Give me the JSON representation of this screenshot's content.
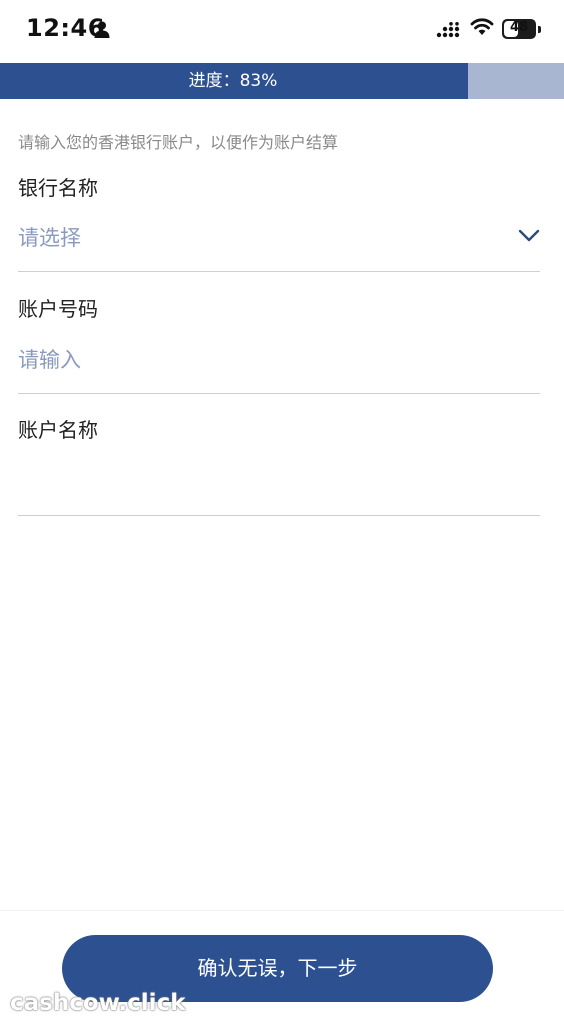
{
  "status_bar": {
    "time": "12:46",
    "battery": "48",
    "battery_level": 0.48
  },
  "progress": {
    "label": "进度：83%",
    "value": 0.83
  },
  "hint": "请输入您的香港银行账户，以便作为账户结算",
  "fields": [
    {
      "label": "银行名称",
      "value": "请选择"
    },
    {
      "label": "账户号码",
      "placeholder": "请输入"
    },
    {
      "label": "账户名称",
      "value": ""
    }
  ],
  "colors": {
    "primary": "#2d5190",
    "progress_track": "#a9b6d2",
    "placeholder": "#8b9bbd"
  },
  "footer": {
    "next_button": "确认无误，下一步"
  },
  "watermark": "cashcow.click"
}
